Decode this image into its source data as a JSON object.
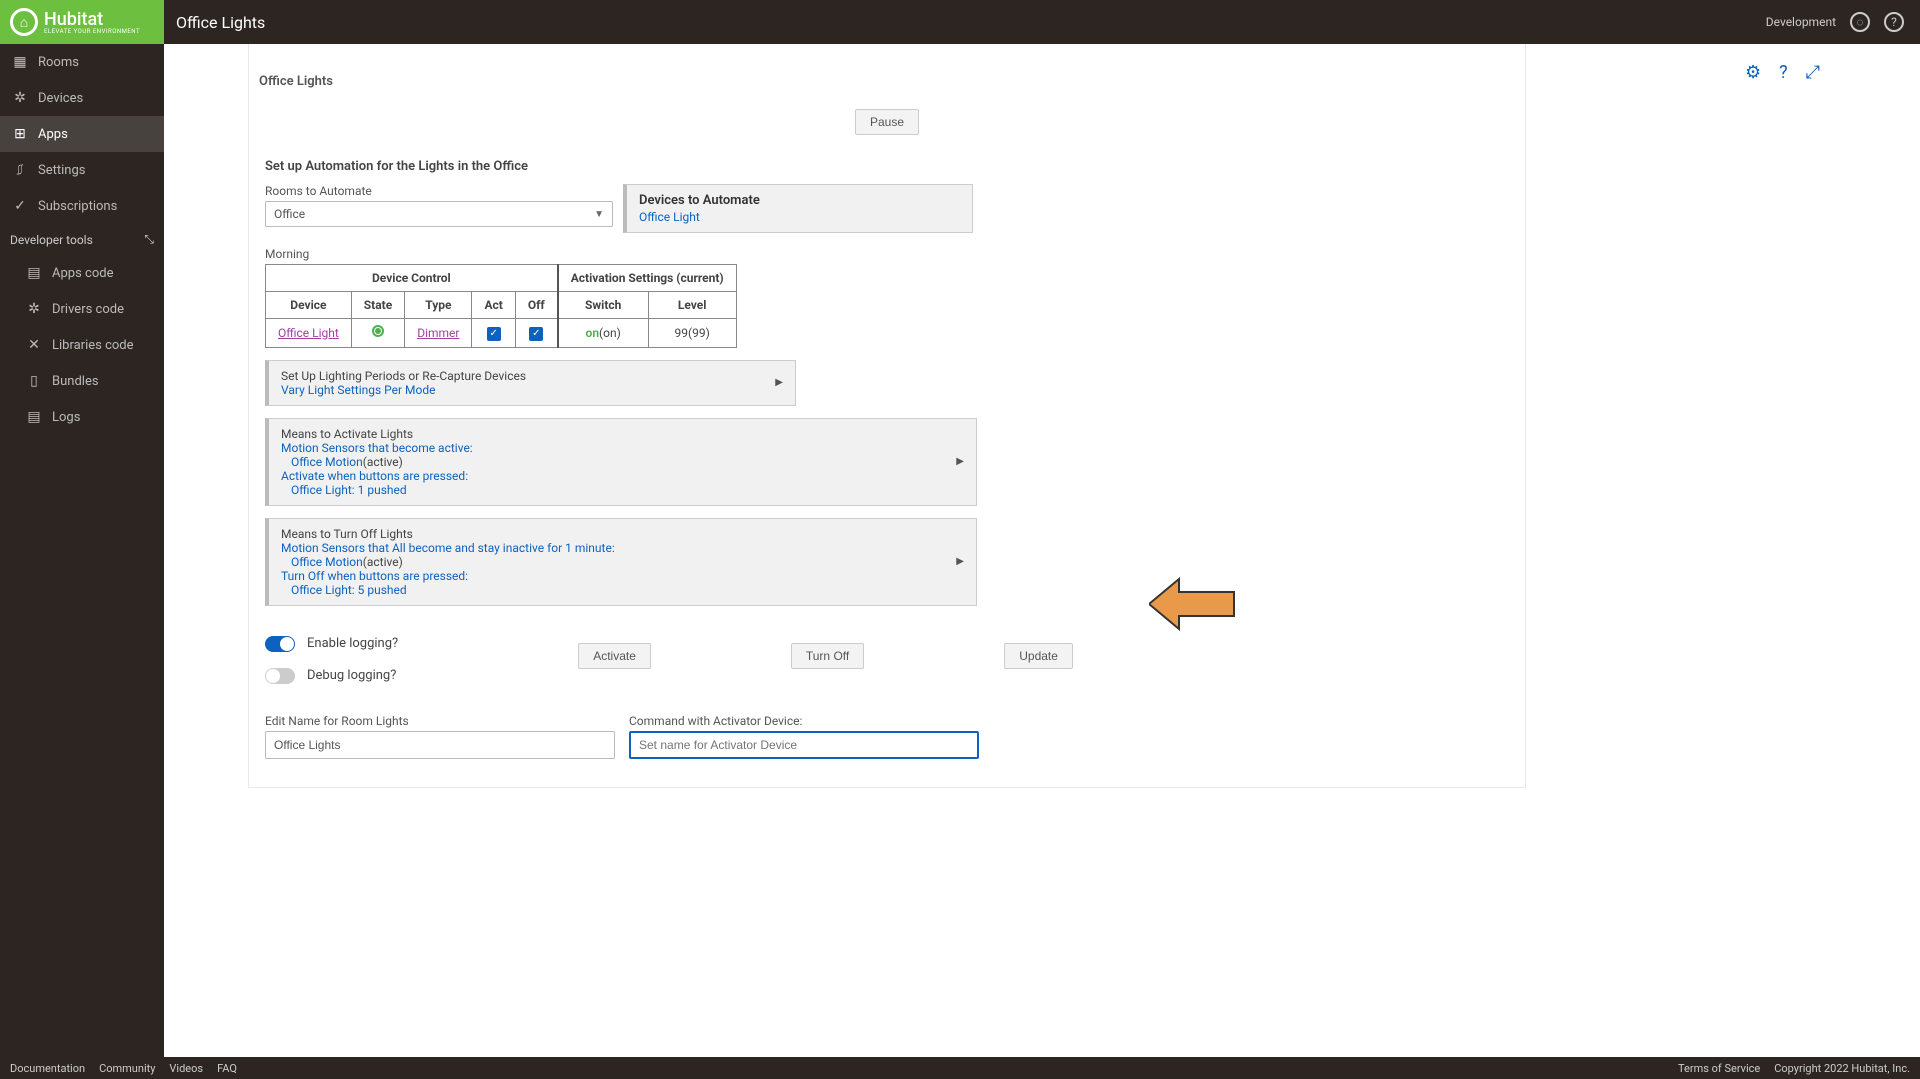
{
  "header": {
    "logo_text": "Hubitat",
    "logo_tagline": "ELEVATE YOUR ENVIRONMENT",
    "page_title": "Office Lights",
    "dev_label": "Development"
  },
  "sidebar": {
    "items": [
      {
        "label": "Rooms",
        "icon": "▦"
      },
      {
        "label": "Devices",
        "icon": "✲"
      },
      {
        "label": "Apps",
        "icon": "⊞",
        "active": true
      },
      {
        "label": "Settings",
        "icon": "⚙"
      },
      {
        "label": "Subscriptions",
        "icon": "✓"
      }
    ],
    "dev_header": "Developer tools",
    "dev_items": [
      {
        "label": "Apps code",
        "icon": "▤"
      },
      {
        "label": "Drivers code",
        "icon": "✲"
      },
      {
        "label": "Libraries code",
        "icon": "✕"
      },
      {
        "label": "Bundles",
        "icon": "▯"
      },
      {
        "label": "Logs",
        "icon": "▤"
      }
    ]
  },
  "content": {
    "title": "Office Lights",
    "pause_label": "Pause",
    "setup_heading": "Set up Automation for the Lights in the Office",
    "rooms_label": "Rooms to Automate",
    "rooms_value": "Office",
    "devices_label": "Devices to Automate",
    "devices_value": "Office Light",
    "period_label": "Morning",
    "table": {
      "h_device_control": "Device Control",
      "h_activation": "Activation Settings (current)",
      "h_device": "Device",
      "h_state": "State",
      "h_type": "Type",
      "h_act": "Act",
      "h_off": "Off",
      "h_switch": "Switch",
      "h_level": "Level",
      "row": {
        "device": "Office Light",
        "type": "Dimmer",
        "switch_on": "on",
        "switch_curr": "(on)",
        "level_val": "99",
        "level_curr": "(99)"
      }
    },
    "panel1": {
      "title": "Set Up Lighting Periods or Re-Capture Devices",
      "link": "Vary Light Settings Per Mode"
    },
    "panel2": {
      "title": "Means to Activate Lights",
      "line1": "Motion Sensors that become active:",
      "line1_sub": "Office Motion",
      "line1_sub2": "(active)",
      "line2": "Activate when buttons are pressed:",
      "line2_sub": "Office Light: 1 pushed"
    },
    "panel3": {
      "title": "Means to Turn Off Lights",
      "line1": "Motion Sensors that All become and stay inactive for 1 minute:",
      "line1_sub": "Office Motion",
      "line1_sub2": "(active)",
      "line2": "Turn Off when buttons are pressed:",
      "line2_sub": "Office Light: 5 pushed"
    },
    "enable_logging": "Enable logging?",
    "debug_logging": "Debug logging?",
    "btn_activate": "Activate",
    "btn_turnoff": "Turn Off",
    "btn_update": "Update",
    "name_label": "Edit Name for Room Lights",
    "name_value": "Office Lights",
    "activator_label": "Command with Activator Device:",
    "activator_placeholder": "Set name for Activator Device"
  },
  "footer": {
    "links": [
      "Documentation",
      "Community",
      "Videos",
      "FAQ"
    ],
    "right": [
      "Terms of Service",
      "Copyright 2022 Hubitat, Inc."
    ]
  }
}
